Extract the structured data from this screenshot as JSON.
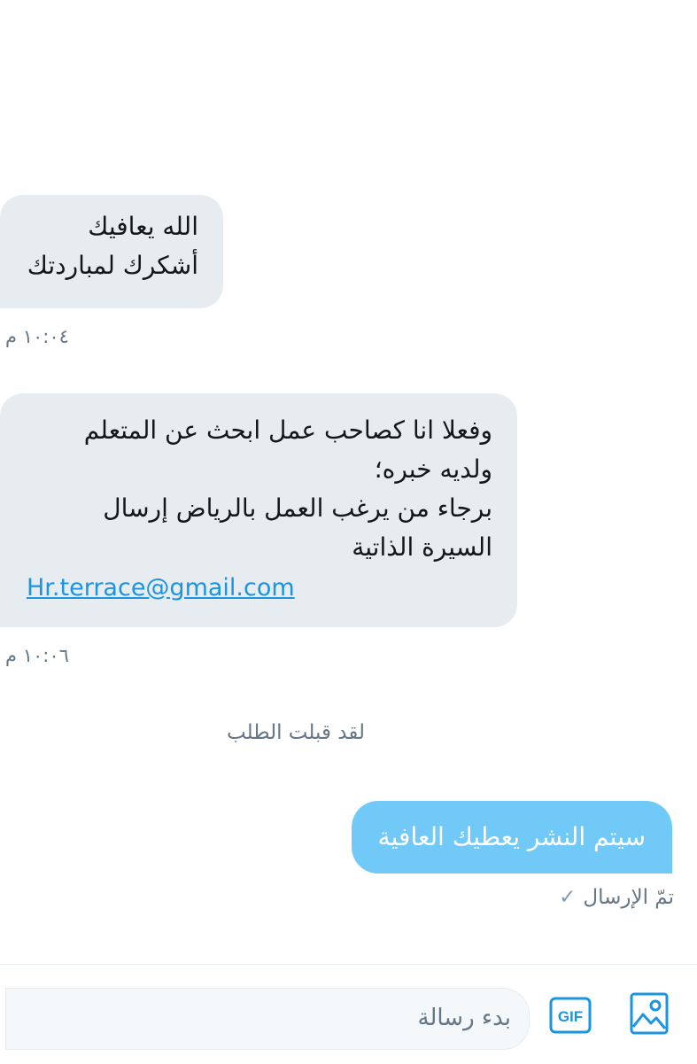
{
  "messages": [
    {
      "direction": "incoming",
      "lines": [
        "الله يعافيك",
        "أشكرك لمباردتك"
      ],
      "time": "١٠:٠٤ م"
    },
    {
      "direction": "incoming",
      "lines": [
        "وفعلا انا كصاحب عمل ابحث عن المتعلم",
        "ولديه خبره؛",
        "برجاء من يرغب العمل بالرياض إرسال",
        "السيرة الذاتية"
      ],
      "link": "Hr.terrace@gmail.com",
      "time": "١٠:٠٦ م"
    }
  ],
  "system_message": "لقد قبلت الطلب",
  "outgoing": {
    "text": "سيتم النشر يعطيك العافية",
    "status": "تمّ الإرسال",
    "status_icon": "✓"
  },
  "composer": {
    "placeholder": "بدء رسالة",
    "gif_label": "GIF",
    "gif_icon": "gif-icon",
    "media_icon": "image-icon"
  },
  "colors": {
    "incoming_bubble": "#e6ecf0",
    "outgoing_bubble": "#71c9f8",
    "accent": "#1b95e0",
    "secondary_text": "#657786"
  }
}
